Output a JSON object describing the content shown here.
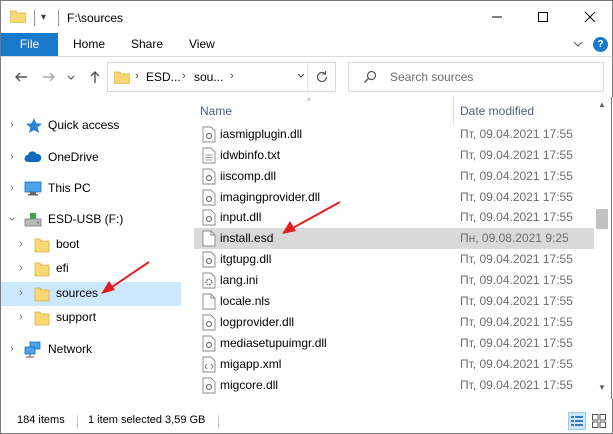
{
  "window": {
    "title": "F:\\sources",
    "qa_arrow": "▾"
  },
  "ribbon": {
    "tabs": [
      "File",
      "Home",
      "Share",
      "View"
    ],
    "help": "?"
  },
  "address": {
    "crumbs": [
      "ESD...",
      "sou..."
    ],
    "search_placeholder": "Search sources"
  },
  "nav": {
    "items": [
      {
        "label": "Quick access",
        "icon": "star-icon"
      },
      {
        "label": "OneDrive",
        "icon": "cloud-icon"
      },
      {
        "label": "This PC",
        "icon": "computer-icon"
      },
      {
        "label": "ESD-USB (F:)",
        "icon": "usb-drive-icon"
      },
      {
        "label": "boot",
        "icon": "folder-icon"
      },
      {
        "label": "efi",
        "icon": "folder-icon"
      },
      {
        "label": "sources",
        "icon": "folder-icon",
        "selected": true
      },
      {
        "label": "support",
        "icon": "folder-icon"
      },
      {
        "label": "Network",
        "icon": "network-icon"
      }
    ]
  },
  "files": {
    "columns": {
      "name": "Name",
      "date": "Date modified"
    },
    "rows": [
      {
        "name": "iasmigplugin.dll",
        "date": "Пт, 09.04.2021 17:55",
        "type": "dll"
      },
      {
        "name": "idwbinfo.txt",
        "date": "Пт, 09.04.2021 17:55",
        "type": "txt"
      },
      {
        "name": "iiscomp.dll",
        "date": "Пт, 09.04.2021 17:55",
        "type": "dll"
      },
      {
        "name": "imagingprovider.dll",
        "date": "Пт, 09.04.2021 17:55",
        "type": "dll"
      },
      {
        "name": "input.dll",
        "date": "Пт, 09.04.2021 17:55",
        "type": "dll"
      },
      {
        "name": "install.esd",
        "date": "Пн, 09.08.2021 9:25",
        "type": "esd",
        "selected": true
      },
      {
        "name": "itgtupg.dll",
        "date": "Пт, 09.04.2021 17:55",
        "type": "dll"
      },
      {
        "name": "lang.ini",
        "date": "Пт, 09.04.2021 17:55",
        "type": "ini"
      },
      {
        "name": "locale.nls",
        "date": "Пт, 09.04.2021 17:55",
        "type": "nls"
      },
      {
        "name": "logprovider.dll",
        "date": "Пт, 09.04.2021 17:55",
        "type": "dll"
      },
      {
        "name": "mediasetupuimgr.dll",
        "date": "Пт, 09.04.2021 17:55",
        "type": "dll"
      },
      {
        "name": "migapp.xml",
        "date": "Пт, 09.04.2021 17:55",
        "type": "xml"
      },
      {
        "name": "migcore.dll",
        "date": "Пт, 09.04.2021 17:55",
        "type": "dll"
      }
    ]
  },
  "status": {
    "count": "184 items",
    "selection": "1 item selected  3,59 GB"
  },
  "colors": {
    "accent": "#1979ca",
    "selection": "#cce8ff",
    "arrow": "#e02020"
  }
}
